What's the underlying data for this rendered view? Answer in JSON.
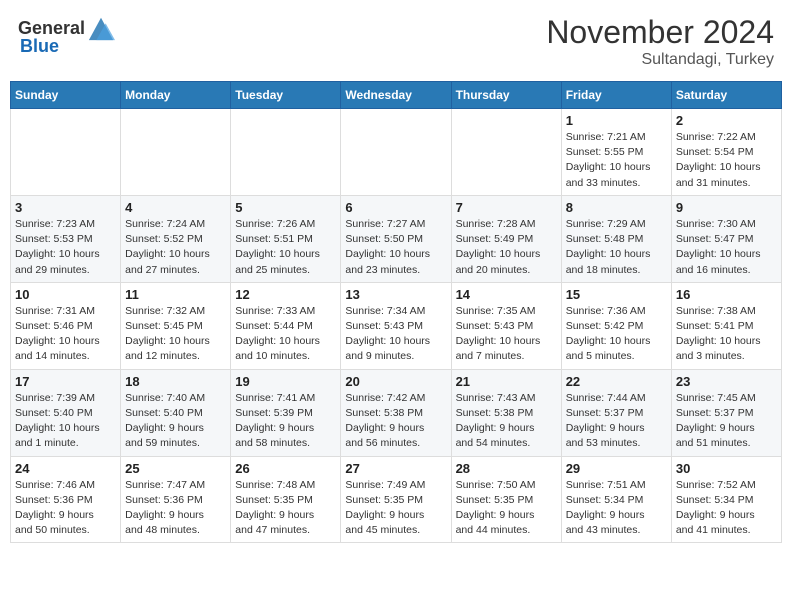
{
  "header": {
    "logo_general": "General",
    "logo_blue": "Blue",
    "month": "November 2024",
    "location": "Sultandagi, Turkey"
  },
  "weekdays": [
    "Sunday",
    "Monday",
    "Tuesday",
    "Wednesday",
    "Thursday",
    "Friday",
    "Saturday"
  ],
  "weeks": [
    [
      {
        "day": "",
        "info": ""
      },
      {
        "day": "",
        "info": ""
      },
      {
        "day": "",
        "info": ""
      },
      {
        "day": "",
        "info": ""
      },
      {
        "day": "",
        "info": ""
      },
      {
        "day": "1",
        "info": "Sunrise: 7:21 AM\nSunset: 5:55 PM\nDaylight: 10 hours\nand 33 minutes."
      },
      {
        "day": "2",
        "info": "Sunrise: 7:22 AM\nSunset: 5:54 PM\nDaylight: 10 hours\nand 31 minutes."
      }
    ],
    [
      {
        "day": "3",
        "info": "Sunrise: 7:23 AM\nSunset: 5:53 PM\nDaylight: 10 hours\nand 29 minutes."
      },
      {
        "day": "4",
        "info": "Sunrise: 7:24 AM\nSunset: 5:52 PM\nDaylight: 10 hours\nand 27 minutes."
      },
      {
        "day": "5",
        "info": "Sunrise: 7:26 AM\nSunset: 5:51 PM\nDaylight: 10 hours\nand 25 minutes."
      },
      {
        "day": "6",
        "info": "Sunrise: 7:27 AM\nSunset: 5:50 PM\nDaylight: 10 hours\nand 23 minutes."
      },
      {
        "day": "7",
        "info": "Sunrise: 7:28 AM\nSunset: 5:49 PM\nDaylight: 10 hours\nand 20 minutes."
      },
      {
        "day": "8",
        "info": "Sunrise: 7:29 AM\nSunset: 5:48 PM\nDaylight: 10 hours\nand 18 minutes."
      },
      {
        "day": "9",
        "info": "Sunrise: 7:30 AM\nSunset: 5:47 PM\nDaylight: 10 hours\nand 16 minutes."
      }
    ],
    [
      {
        "day": "10",
        "info": "Sunrise: 7:31 AM\nSunset: 5:46 PM\nDaylight: 10 hours\nand 14 minutes."
      },
      {
        "day": "11",
        "info": "Sunrise: 7:32 AM\nSunset: 5:45 PM\nDaylight: 10 hours\nand 12 minutes."
      },
      {
        "day": "12",
        "info": "Sunrise: 7:33 AM\nSunset: 5:44 PM\nDaylight: 10 hours\nand 10 minutes."
      },
      {
        "day": "13",
        "info": "Sunrise: 7:34 AM\nSunset: 5:43 PM\nDaylight: 10 hours\nand 9 minutes."
      },
      {
        "day": "14",
        "info": "Sunrise: 7:35 AM\nSunset: 5:43 PM\nDaylight: 10 hours\nand 7 minutes."
      },
      {
        "day": "15",
        "info": "Sunrise: 7:36 AM\nSunset: 5:42 PM\nDaylight: 10 hours\nand 5 minutes."
      },
      {
        "day": "16",
        "info": "Sunrise: 7:38 AM\nSunset: 5:41 PM\nDaylight: 10 hours\nand 3 minutes."
      }
    ],
    [
      {
        "day": "17",
        "info": "Sunrise: 7:39 AM\nSunset: 5:40 PM\nDaylight: 10 hours\nand 1 minute."
      },
      {
        "day": "18",
        "info": "Sunrise: 7:40 AM\nSunset: 5:40 PM\nDaylight: 9 hours\nand 59 minutes."
      },
      {
        "day": "19",
        "info": "Sunrise: 7:41 AM\nSunset: 5:39 PM\nDaylight: 9 hours\nand 58 minutes."
      },
      {
        "day": "20",
        "info": "Sunrise: 7:42 AM\nSunset: 5:38 PM\nDaylight: 9 hours\nand 56 minutes."
      },
      {
        "day": "21",
        "info": "Sunrise: 7:43 AM\nSunset: 5:38 PM\nDaylight: 9 hours\nand 54 minutes."
      },
      {
        "day": "22",
        "info": "Sunrise: 7:44 AM\nSunset: 5:37 PM\nDaylight: 9 hours\nand 53 minutes."
      },
      {
        "day": "23",
        "info": "Sunrise: 7:45 AM\nSunset: 5:37 PM\nDaylight: 9 hours\nand 51 minutes."
      }
    ],
    [
      {
        "day": "24",
        "info": "Sunrise: 7:46 AM\nSunset: 5:36 PM\nDaylight: 9 hours\nand 50 minutes."
      },
      {
        "day": "25",
        "info": "Sunrise: 7:47 AM\nSunset: 5:36 PM\nDaylight: 9 hours\nand 48 minutes."
      },
      {
        "day": "26",
        "info": "Sunrise: 7:48 AM\nSunset: 5:35 PM\nDaylight: 9 hours\nand 47 minutes."
      },
      {
        "day": "27",
        "info": "Sunrise: 7:49 AM\nSunset: 5:35 PM\nDaylight: 9 hours\nand 45 minutes."
      },
      {
        "day": "28",
        "info": "Sunrise: 7:50 AM\nSunset: 5:35 PM\nDaylight: 9 hours\nand 44 minutes."
      },
      {
        "day": "29",
        "info": "Sunrise: 7:51 AM\nSunset: 5:34 PM\nDaylight: 9 hours\nand 43 minutes."
      },
      {
        "day": "30",
        "info": "Sunrise: 7:52 AM\nSunset: 5:34 PM\nDaylight: 9 hours\nand 41 minutes."
      }
    ]
  ]
}
